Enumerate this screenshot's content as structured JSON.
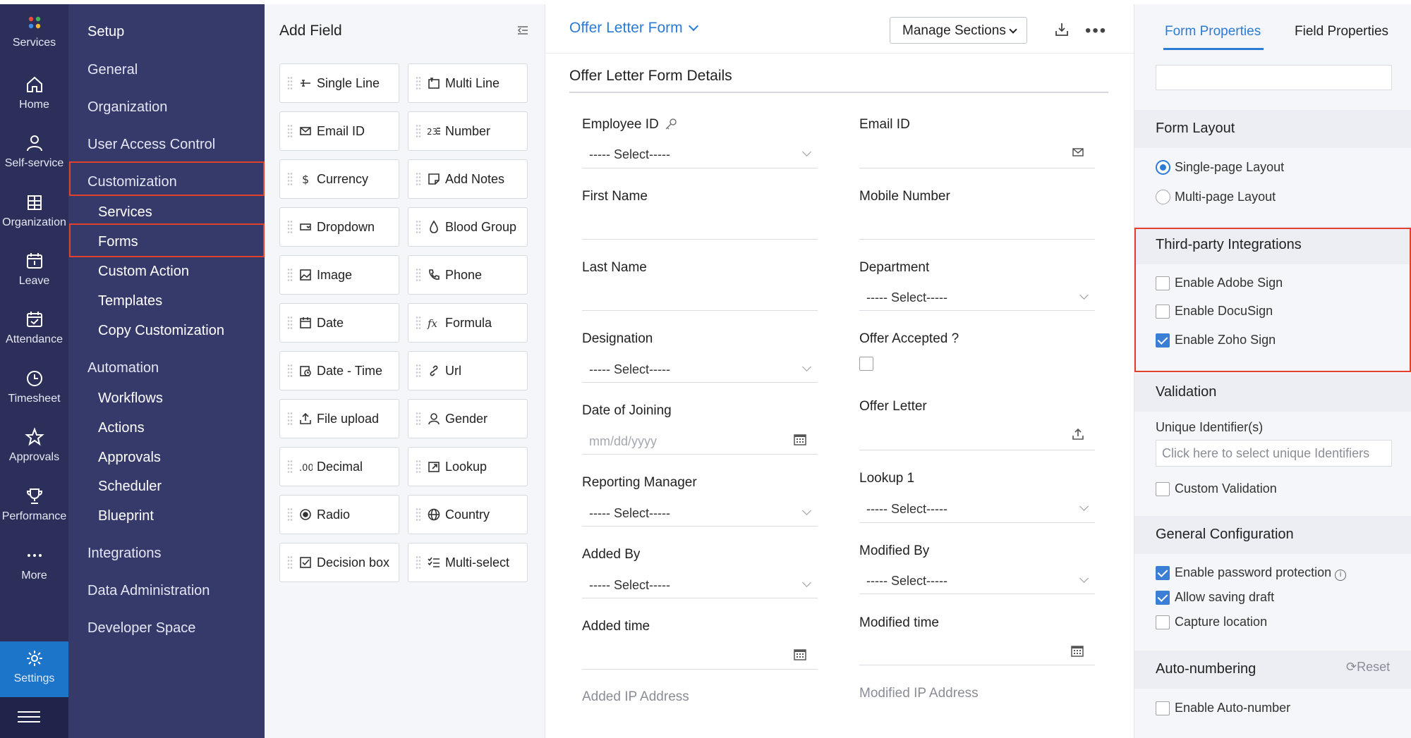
{
  "rail": {
    "items": [
      {
        "label": "Services",
        "icon": "services-icon"
      },
      {
        "label": "Home",
        "icon": "home-icon"
      },
      {
        "label": "Self-service",
        "icon": "user-icon"
      },
      {
        "label": "Organization",
        "icon": "organization-icon"
      },
      {
        "label": "Leave",
        "icon": "leave-icon"
      },
      {
        "label": "Attendance",
        "icon": "attendance-icon"
      },
      {
        "label": "Timesheet",
        "icon": "clock-icon"
      },
      {
        "label": "Approvals",
        "icon": "star-icon"
      },
      {
        "label": "Performance",
        "icon": "trophy-icon"
      },
      {
        "label": "More",
        "icon": "more-icon"
      },
      {
        "label": "Settings",
        "icon": "gear-icon"
      }
    ],
    "colors": {
      "bg": "#2b2f59",
      "active": "#1c75c8"
    }
  },
  "menu": {
    "title": "Setup",
    "sections": [
      {
        "label": "General"
      },
      {
        "label": "Organization"
      },
      {
        "label": "User Access Control"
      },
      {
        "label": "Customization",
        "items": [
          "Services",
          "Forms",
          "Custom Action",
          "Templates",
          "Copy Customization"
        ]
      },
      {
        "label": "Automation",
        "items": [
          "Workflows",
          "Actions",
          "Approvals",
          "Scheduler",
          "Blueprint"
        ]
      },
      {
        "label": "Integrations"
      },
      {
        "label": "Data Administration"
      },
      {
        "label": "Developer Space"
      }
    ],
    "highlight_color": "#e2412d"
  },
  "addfield": {
    "title": "Add Field",
    "fields": [
      [
        "Single Line",
        "Multi Line"
      ],
      [
        "Email ID",
        "Number"
      ],
      [
        "Currency",
        "Add Notes"
      ],
      [
        "Dropdown",
        "Blood Group"
      ],
      [
        "Image",
        "Phone"
      ],
      [
        "Date",
        "Formula"
      ],
      [
        "Date - Time",
        "Url"
      ],
      [
        "File upload",
        "Gender"
      ],
      [
        "Decimal",
        "Lookup"
      ],
      [
        "Radio",
        "Country"
      ],
      [
        "Decision box",
        "Multi-select"
      ]
    ]
  },
  "form": {
    "name": "Offer Letter Form",
    "manage_sections": "Manage Sections",
    "section_title": "Offer Letter Form Details",
    "select_placeholder": "----- Select-----",
    "date_placeholder": "mm/dd/yyyy",
    "left": [
      "Employee ID",
      "First Name",
      "Last Name",
      "Designation",
      "Date of Joining",
      "Reporting Manager",
      "Added By",
      "Added time",
      "Added IP Address"
    ],
    "right": [
      "Email ID",
      "Mobile Number",
      "Department",
      "Offer Accepted ?",
      "Offer Letter",
      "Lookup 1",
      "Modified By",
      "Modified time",
      "Modified IP Address"
    ],
    "accent": "#2b7bd6"
  },
  "props": {
    "tabs": [
      "Form Properties",
      "Field Properties"
    ],
    "form_layout": {
      "title": "Form Layout",
      "options": [
        "Single-page Layout",
        "Multi-page Layout"
      ],
      "selected": "Single-page Layout"
    },
    "third_party": {
      "title": "Third-party Integrations",
      "options": [
        {
          "label": "Enable Adobe Sign",
          "checked": false
        },
        {
          "label": "Enable DocuSign",
          "checked": false
        },
        {
          "label": "Enable Zoho Sign",
          "checked": true
        }
      ]
    },
    "validation": {
      "title": "Validation",
      "unique_label": "Unique Identifier(s)",
      "unique_placeholder": "Click here to select unique Identifiers",
      "custom_validation": "Custom Validation"
    },
    "general": {
      "title": "General Configuration",
      "options": [
        {
          "label": "Enable password protection",
          "checked": true
        },
        {
          "label": "Allow saving draft",
          "checked": true
        },
        {
          "label": "Capture location",
          "checked": false
        }
      ]
    },
    "autonumber": {
      "title": "Auto-numbering",
      "reset": "Reset",
      "enable": "Enable Auto-number"
    }
  }
}
